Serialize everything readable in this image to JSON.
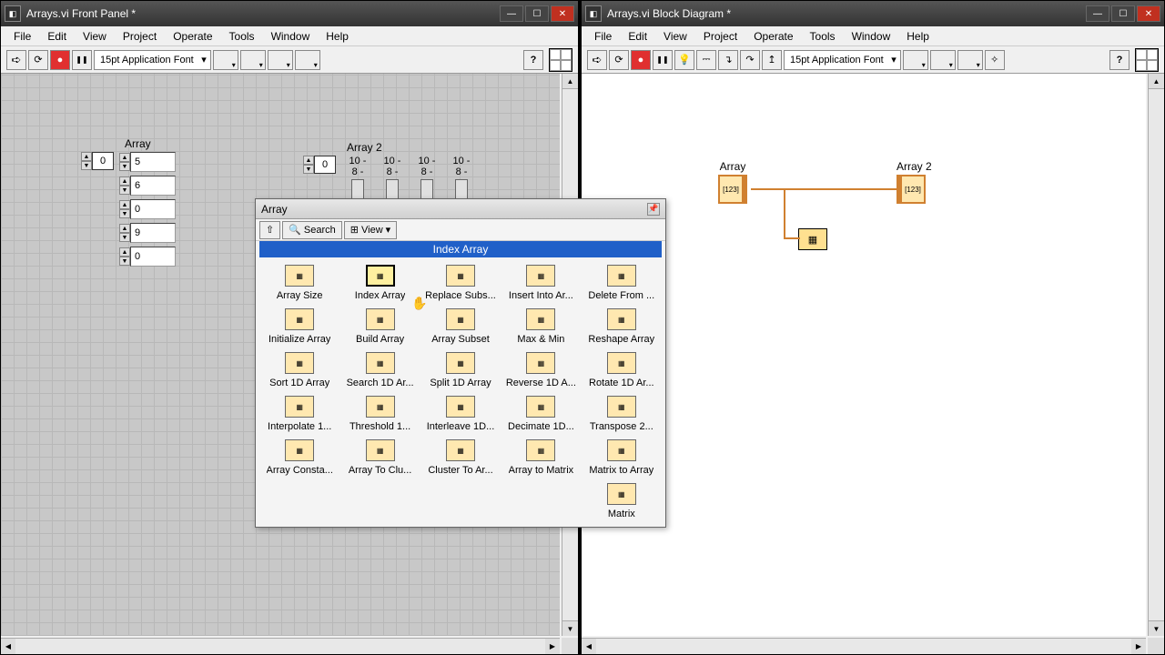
{
  "front": {
    "title": "Arrays.vi Front Panel *",
    "menus": [
      "File",
      "Edit",
      "View",
      "Project",
      "Operate",
      "Tools",
      "Window",
      "Help"
    ],
    "font": "15pt Application Font",
    "array1": {
      "label": "Array",
      "index": "0",
      "values": [
        "5",
        "6",
        "0",
        "9",
        "0"
      ]
    },
    "array2": {
      "label": "Array 2",
      "index": "0",
      "cols": [
        {
          "top": "10",
          "bot": "8"
        },
        {
          "top": "10",
          "bot": "8"
        },
        {
          "top": "10",
          "bot": "8"
        },
        {
          "top": "10",
          "bot": "8"
        }
      ]
    }
  },
  "block": {
    "title": "Arrays.vi Block Diagram *",
    "menus": [
      "File",
      "Edit",
      "View",
      "Project",
      "Operate",
      "Tools",
      "Window",
      "Help"
    ],
    "font": "15pt Application Font",
    "nodes": {
      "src": "Array",
      "dst": "Array 2"
    }
  },
  "palette": {
    "title": "Array",
    "search": "Search",
    "view": "View",
    "hint": "Index Array",
    "items": [
      "Array Size",
      "Index Array",
      "Replace Subs...",
      "Insert Into Ar...",
      "Delete From ...",
      "Initialize Array",
      "Build Array",
      "Array Subset",
      "Max & Min",
      "Reshape Array",
      "Sort 1D Array",
      "Search 1D Ar...",
      "Split 1D Array",
      "Reverse 1D A...",
      "Rotate 1D Ar...",
      "Interpolate 1...",
      "Threshold 1...",
      "Interleave 1D...",
      "Decimate 1D...",
      "Transpose 2...",
      "Array Consta...",
      "Array To Clu...",
      "Cluster To Ar...",
      "Array to Matrix",
      "Matrix to Array",
      "",
      "",
      "",
      "",
      "Matrix"
    ],
    "selected": 1
  }
}
